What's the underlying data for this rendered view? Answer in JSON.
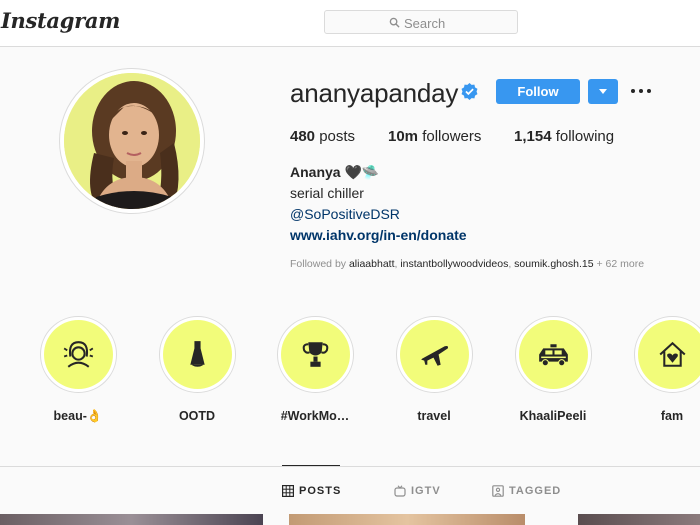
{
  "nav": {
    "logo": "Instagram",
    "search_placeholder": "Search"
  },
  "profile": {
    "username": "ananyapanday",
    "follow_label": "Follow",
    "stats": {
      "posts_count": "480",
      "posts_label": "posts",
      "followers_count": "10m",
      "followers_label": "followers",
      "following_count": "1,154",
      "following_label": "following"
    },
    "full_name": "Ananya 🖤🛸",
    "bio": "serial chiller",
    "mention": "@SoPositiveDSR",
    "website": "www.iahv.org/in-en/donate",
    "followed_by_prefix": "Followed by",
    "followed_by_accounts": [
      "aliaabhatt",
      "instantbollywoodvideos",
      "soumik.ghosh.15"
    ],
    "followed_by_more": "+ 62 more"
  },
  "highlights": [
    {
      "label": "beau-👌",
      "icon": "woman-face-icon"
    },
    {
      "label": "OOTD",
      "icon": "dress-icon"
    },
    {
      "label": "#WorkMo…",
      "icon": "trophy-icon"
    },
    {
      "label": "travel",
      "icon": "airplane-icon"
    },
    {
      "label": "KhaaliPeeli",
      "icon": "taxi-icon"
    },
    {
      "label": "fam",
      "icon": "home-heart-icon"
    }
  ],
  "tabs": [
    {
      "label": "POSTS",
      "icon": "grid-icon",
      "active": true
    },
    {
      "label": "IGTV",
      "icon": "igtv-icon",
      "active": false
    },
    {
      "label": "TAGGED",
      "icon": "tag-icon",
      "active": false
    }
  ],
  "colors": {
    "accent": "#3897f0",
    "highlight_bg": "#f2fc7a",
    "link": "#003569"
  }
}
